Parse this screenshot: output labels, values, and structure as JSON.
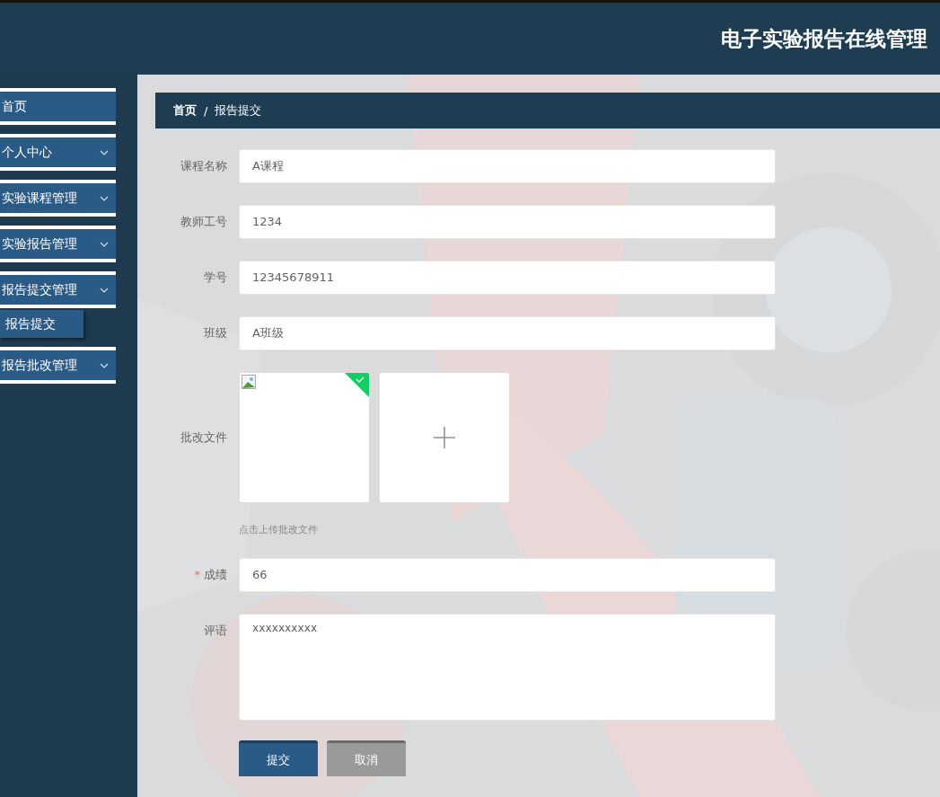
{
  "header": {
    "title": "电子实验报告在线管理"
  },
  "sidebar": {
    "items": [
      {
        "label": "首页",
        "kind": "link"
      },
      {
        "label": "个人中心",
        "kind": "menu"
      },
      {
        "label": "实验课程管理",
        "kind": "menu"
      },
      {
        "label": "实验报告管理",
        "kind": "menu"
      },
      {
        "label": "报告提交管理",
        "kind": "menu",
        "children": [
          {
            "label": "报告提交"
          }
        ]
      },
      {
        "label": "报告批改管理",
        "kind": "menu"
      }
    ]
  },
  "breadcrumb": {
    "items": [
      "首页",
      "报告提交"
    ],
    "separator": "/"
  },
  "form": {
    "required_marker": "*",
    "fields": [
      {
        "kind": "text",
        "label": "课程名称",
        "value": "A课程"
      },
      {
        "kind": "text",
        "label": "教师工号",
        "value": "1234"
      },
      {
        "kind": "text",
        "label": "学号",
        "value": "12345678911"
      },
      {
        "kind": "text",
        "label": "班级",
        "value": "A班级"
      },
      {
        "kind": "upload",
        "label": "批改文件",
        "uploaded": true,
        "hint": "点击上传批改文件"
      },
      {
        "kind": "text",
        "label": "成绩",
        "value": "66",
        "required": true
      },
      {
        "kind": "textarea",
        "label": "评语",
        "value": "xxxxxxxxxx"
      }
    ],
    "buttons": [
      {
        "label": "提交",
        "kind": "primary"
      },
      {
        "label": "取消",
        "kind": "secondary"
      }
    ]
  }
}
